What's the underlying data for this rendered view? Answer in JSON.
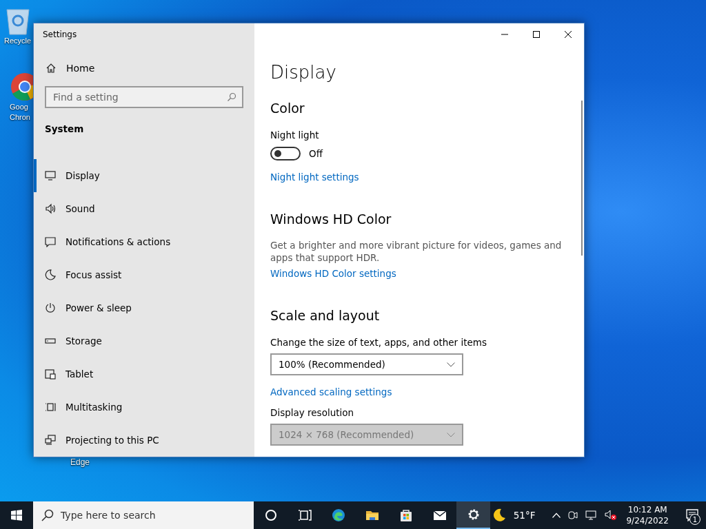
{
  "desktop_icons": [
    {
      "kind": "recycle-bin",
      "label_lines": [
        "Recycle"
      ]
    },
    {
      "kind": "chrome",
      "label_lines": [
        "Goog",
        "Chron"
      ]
    },
    {
      "kind": "label-only",
      "label_lines": [
        "Edge"
      ]
    }
  ],
  "window": {
    "title": "Settings",
    "sidebar": {
      "home": "Home",
      "search": {
        "placeholder": "Find a setting"
      },
      "section": "System",
      "items": [
        {
          "kind": "display",
          "label": "Display",
          "selected": true
        },
        {
          "kind": "sound",
          "label": "Sound",
          "selected": false
        },
        {
          "kind": "notifications",
          "label": "Notifications & actions",
          "selected": false
        },
        {
          "kind": "focus",
          "label": "Focus assist",
          "selected": false
        },
        {
          "kind": "power",
          "label": "Power & sleep",
          "selected": false
        },
        {
          "kind": "storage",
          "label": "Storage",
          "selected": false
        },
        {
          "kind": "tablet",
          "label": "Tablet",
          "selected": false
        },
        {
          "kind": "multitasking",
          "label": "Multitasking",
          "selected": false
        },
        {
          "kind": "projecting",
          "label": "Projecting to this PC",
          "selected": false
        }
      ]
    },
    "content": {
      "page_title": "Display",
      "blocks": [
        {
          "kind": "heading",
          "text": "Color"
        },
        {
          "kind": "label",
          "text": "Night light"
        },
        {
          "kind": "toggle",
          "on": false,
          "text": "Off"
        },
        {
          "kind": "link",
          "text": "Night light settings"
        },
        {
          "kind": "heading",
          "text": "Windows HD Color"
        },
        {
          "kind": "description",
          "text": "Get a brighter and more vibrant picture for videos, games and apps that support HDR."
        },
        {
          "kind": "link",
          "text": "Windows HD Color settings"
        },
        {
          "kind": "heading",
          "text": "Scale and layout"
        },
        {
          "kind": "label",
          "text": "Change the size of text, apps, and other items"
        },
        {
          "kind": "dropdown",
          "value": "100% (Recommended)",
          "disabled": false
        },
        {
          "kind": "link",
          "text": "Advanced scaling settings"
        },
        {
          "kind": "label",
          "text": "Display resolution"
        },
        {
          "kind": "dropdown",
          "value": "1024 × 768 (Recommended)",
          "disabled": true
        }
      ]
    }
  },
  "taskbar": {
    "search": {
      "placeholder": "Type here to search"
    },
    "apps": [
      {
        "kind": "cortana",
        "selected": false
      },
      {
        "kind": "task-view",
        "selected": false
      },
      {
        "kind": "edge",
        "selected": false
      },
      {
        "kind": "explorer",
        "selected": false
      },
      {
        "kind": "store",
        "selected": false
      },
      {
        "kind": "mail",
        "selected": false
      },
      {
        "kind": "settings",
        "selected": true
      }
    ],
    "weather": {
      "temperature": "51°F"
    },
    "clock": {
      "time": "10:12 AM",
      "date": "9/24/2022"
    },
    "notifications": {
      "count": "1"
    }
  }
}
